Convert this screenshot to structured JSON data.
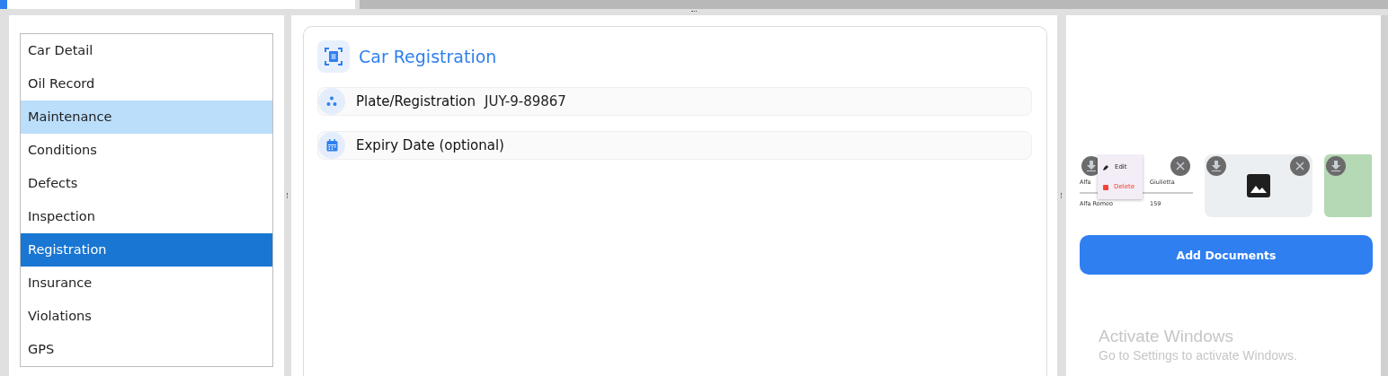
{
  "sidebar": {
    "items": [
      {
        "label": "Car Detail",
        "selected": false,
        "hovered": false
      },
      {
        "label": "Oil Record",
        "selected": false,
        "hovered": false
      },
      {
        "label": "Maintenance",
        "selected": false,
        "hovered": true
      },
      {
        "label": "Conditions",
        "selected": false,
        "hovered": false
      },
      {
        "label": "Defects",
        "selected": false,
        "hovered": false
      },
      {
        "label": "Inspection",
        "selected": false,
        "hovered": false
      },
      {
        "label": "Registration",
        "selected": true,
        "hovered": false
      },
      {
        "label": "Insurance",
        "selected": false,
        "hovered": false
      },
      {
        "label": "Violations",
        "selected": false,
        "hovered": false
      },
      {
        "label": "GPS",
        "selected": false,
        "hovered": false
      }
    ]
  },
  "card": {
    "title": "Car Registration",
    "fields": [
      {
        "kind": "plate",
        "label": "Plate/Registration",
        "value": "JUY-9-89867"
      },
      {
        "kind": "date",
        "label": "Expiry Date (optional)"
      }
    ]
  },
  "documents": {
    "items": [
      {
        "kind": "table",
        "cells": [
          "Alfa",
          "Giulietta",
          "Alfa Romeo",
          "159"
        ],
        "menu": [
          {
            "kind": "edit",
            "label": "Edit"
          },
          {
            "kind": "delete",
            "label": "Delete"
          }
        ],
        "removable": true
      },
      {
        "kind": "empty",
        "removable": true
      },
      {
        "kind": "photo",
        "removable": false
      }
    ],
    "add_button": "Add Documents"
  },
  "os_notice": {
    "title": "Activate Windows",
    "text": "Go to Settings to activate Windows."
  }
}
